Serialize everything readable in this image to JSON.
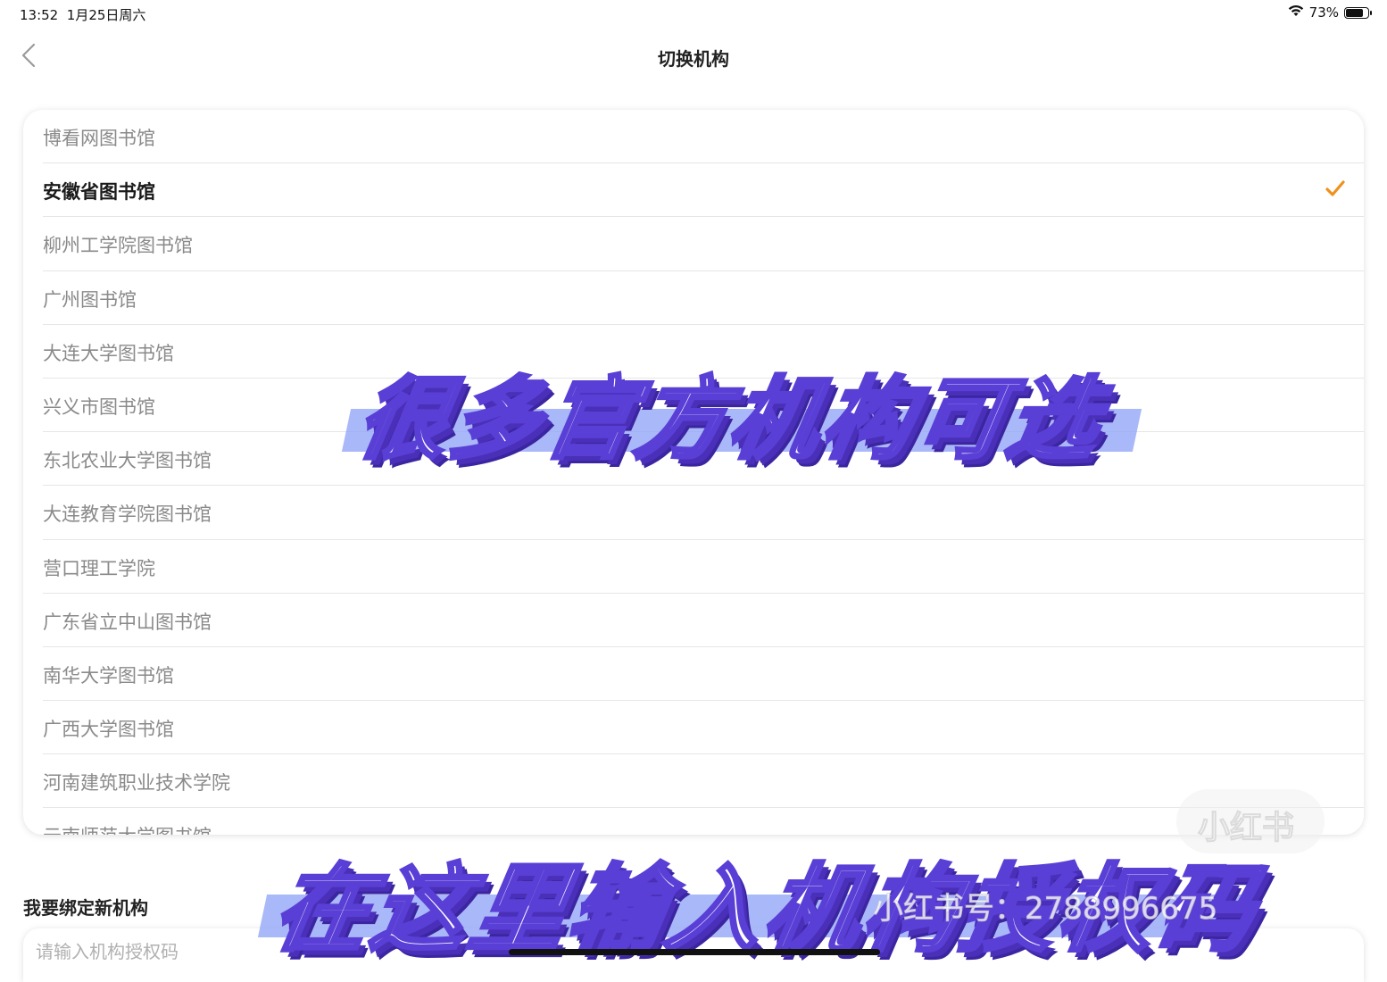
{
  "status_bar": {
    "time": "13:52",
    "date": "1月25日周六",
    "battery_percent": "73%",
    "battery_level": 0.73
  },
  "nav": {
    "title": "切换机构"
  },
  "institutions": [
    {
      "name": "博看网图书馆",
      "selected": false
    },
    {
      "name": "安徽省图书馆",
      "selected": true
    },
    {
      "name": "柳州工学院图书馆",
      "selected": false
    },
    {
      "name": "广州图书馆",
      "selected": false
    },
    {
      "name": "大连大学图书馆",
      "selected": false
    },
    {
      "name": "兴义市图书馆",
      "selected": false
    },
    {
      "name": "东北农业大学图书馆",
      "selected": false
    },
    {
      "name": "大连教育学院图书馆",
      "selected": false
    },
    {
      "name": "营口理工学院",
      "selected": false
    },
    {
      "name": "广东省立中山图书馆",
      "selected": false
    },
    {
      "name": "南华大学图书馆",
      "selected": false
    },
    {
      "name": "广西大学图书馆",
      "selected": false
    },
    {
      "name": "河南建筑职业技术学院",
      "selected": false
    },
    {
      "name": "云南师范大学图书馆",
      "selected": false
    }
  ],
  "bind_section": {
    "title": "我要绑定新机构",
    "placeholder": "请输入机构授权码"
  },
  "overlay": {
    "caption_top": "很多官方机构可选",
    "caption_bottom": "在这里输入机构授权码"
  },
  "watermark": {
    "badge": "小红书",
    "id_text": "小红书号：2788996675"
  },
  "colors": {
    "accent_check": "#f0901e",
    "overlay_stroke": "#5a3fd6",
    "overlay_stripe": "#8ca0f5"
  }
}
